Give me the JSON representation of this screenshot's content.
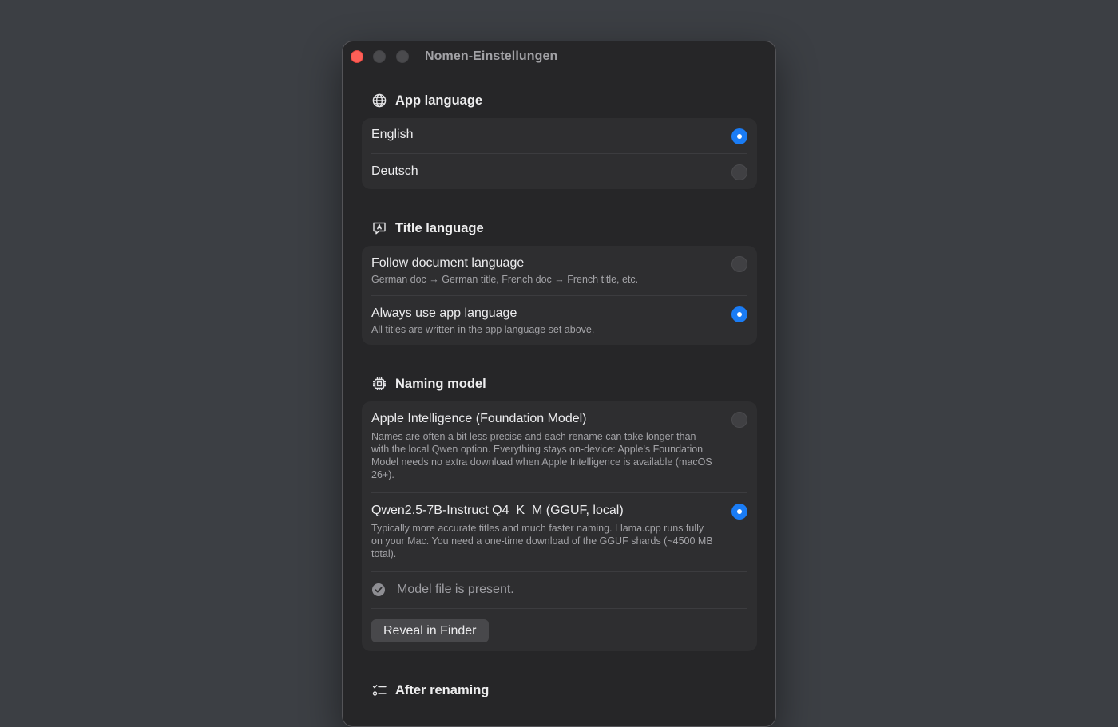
{
  "window": {
    "title": "Nomen-Einstellungen"
  },
  "app_language": {
    "title": "App language",
    "icon": "globe-icon",
    "options": [
      {
        "label": "English",
        "selected": true
      },
      {
        "label": "Deutsch",
        "selected": false
      }
    ]
  },
  "title_language": {
    "title": "Title language",
    "icon": "speech-bubble-a-icon",
    "options": [
      {
        "label": "Follow document language",
        "description": "German doc → German title, French doc → French title, etc.",
        "selected": false
      },
      {
        "label": "Always use app language",
        "description": "All titles are written in the app language set above.",
        "selected": true
      }
    ]
  },
  "naming_model": {
    "title": "Naming model",
    "icon": "cpu-chip-icon",
    "options": [
      {
        "label": "Apple Intelligence (Foundation Model)",
        "description": "Names are often a bit less precise and each rename can take longer than with the local Qwen option. Everything stays on-device: Apple's Foundation Model needs no extra download when Apple Intelligence is available (macOS 26+).",
        "selected": false
      },
      {
        "label": "Qwen2.5-7B-Instruct Q4_K_M (GGUF, local)",
        "description": "Typically more accurate titles and much faster naming. Llama.cpp runs fully on your Mac. You need a one-time download of the GGUF shards (~4500 MB total).",
        "selected": true
      }
    ],
    "status": "Model file is present.",
    "status_icon": "checkmark-circle-icon",
    "reveal_button": "Reveal in Finder"
  },
  "after_renaming": {
    "title": "After renaming",
    "icon": "checklist-icon"
  },
  "colors": {
    "accent": "#1a7cf5",
    "close": "#fe5f57",
    "background": "#3c3f44",
    "window": "#262628",
    "group": "#2e2e30"
  }
}
